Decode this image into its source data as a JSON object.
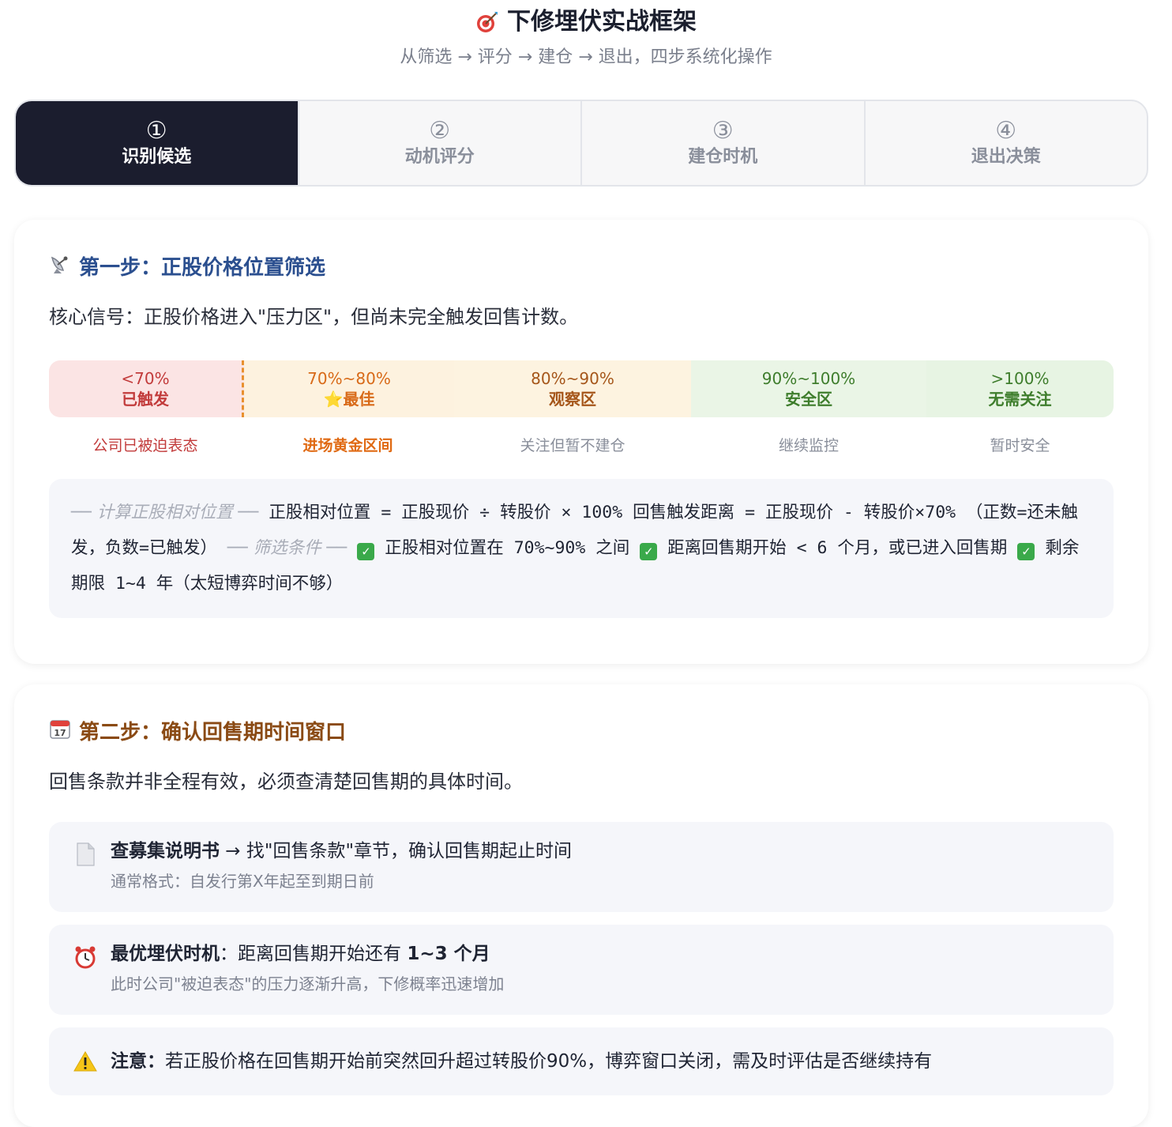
{
  "header": {
    "title": "下修埋伏实战框架",
    "title_icon": "target-icon",
    "subtitle": "从筛选 → 评分 → 建仓 → 退出，四步系统化操作"
  },
  "tabs": [
    {
      "num": "①",
      "label": "识别候选",
      "active": true
    },
    {
      "num": "②",
      "label": "动机评分",
      "active": false
    },
    {
      "num": "③",
      "label": "建仓时机",
      "active": false
    },
    {
      "num": "④",
      "label": "退出决策",
      "active": false
    }
  ],
  "step1": {
    "icon": "satellite-dish-icon",
    "title": "第一步：正股价格位置筛选",
    "desc": "核心信号：正股价格进入\"压力区\"，但尚未完全触发回售计数。",
    "zones": [
      {
        "range": "<70%",
        "name": "已触发",
        "note": "公司已被迫表态"
      },
      {
        "range": "70%~80%",
        "name": "⭐最佳",
        "note": "进场黄金区间"
      },
      {
        "range": "80%~90%",
        "name": "观察区",
        "note": "关注但暂不建仓"
      },
      {
        "range": "90%~100%",
        "name": "安全区",
        "note": "继续监控"
      },
      {
        "range": ">100%",
        "name": "无需关注",
        "note": "暂时安全"
      }
    ],
    "formula": {
      "calc_header": "── 计算正股相对位置 ──",
      "calc_line1": "正股相对位置 = 正股现价 ÷ 转股价 × 100%",
      "calc_line2": "回售触发距离 = 正股现价 - 转股价×70%",
      "calc_line3": "（正数=还未触发，负数=已触发）",
      "filter_header": "── 筛选条件 ──",
      "cond1": "正股相对位置在 70%~90% 之间",
      "cond2": "距离回售期开始 < 6 个月，或已进入回售期",
      "cond3": "剩余期限 1~4 年（太短博弈时间不够）"
    }
  },
  "step2": {
    "icon": "calendar-icon",
    "title": "第二步：确认回售期时间窗口",
    "desc": "回售条款并非全程有效，必须查清楚回售期的具体时间。",
    "items": [
      {
        "icon": "document-icon",
        "bold": "查募集说明书",
        "text": " → 找\"回售条款\"章节，确认回售期起止时间",
        "sub": "通常格式：自发行第X年起至到期日前"
      },
      {
        "icon": "alarm-clock-icon",
        "bold": "最优埋伏时机",
        "text": "：距离回售期开始还有 ",
        "bold2": "1~3 个月",
        "sub": "此时公司\"被迫表态\"的压力逐渐升高，下修概率迅速增加"
      },
      {
        "icon": "warning-icon",
        "bold": "注意：",
        "text": "若正股价格在回售期开始前突然回升超过转股价90%，博弈窗口关闭，需及时评估是否继续持有"
      }
    ]
  }
}
